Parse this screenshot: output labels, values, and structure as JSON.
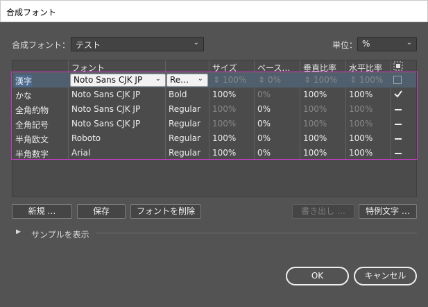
{
  "window": {
    "title": "合成フォント"
  },
  "composite_font": {
    "label": "合成フォント：",
    "value": "テスト"
  },
  "unit": {
    "label": "単位：",
    "value": "%"
  },
  "table": {
    "headers": {
      "font": "フォント",
      "size": "サイズ",
      "baseline": "ベース…",
      "vscale": "垂直比率",
      "hscale": "水平比率",
      "center_icon": "center-align-icon"
    },
    "rows": [
      {
        "category": "漢字",
        "font": "Noto Sans CJK JP",
        "style": "Re…",
        "size": "100%",
        "baseline": "0%",
        "vscale": "100%",
        "hscale": "100%",
        "check": "checkbox-empty"
      },
      {
        "category": "かな",
        "font": "Noto Sans CJK JP",
        "style": "Bold",
        "size": "100%",
        "baseline": "0%",
        "vscale": "100%",
        "hscale": "100%",
        "check": "checkmark"
      },
      {
        "category": "全角約物",
        "font": "Noto Sans CJK JP",
        "style": "Regular",
        "size": "100%",
        "baseline": "0%",
        "vscale": "100%",
        "hscale": "100%",
        "check": "dash"
      },
      {
        "category": "全角記号",
        "font": "Noto Sans CJK JP",
        "style": "Regular",
        "size": "100%",
        "baseline": "0%",
        "vscale": "100%",
        "hscale": "100%",
        "check": "dash"
      },
      {
        "category": "半角欧文",
        "font": "Roboto",
        "style": "Regular",
        "size": "100%",
        "baseline": "0%",
        "vscale": "100%",
        "hscale": "100%",
        "check": "dash"
      },
      {
        "category": "半角数字",
        "font": "Arial",
        "style": "Regular",
        "size": "100%",
        "baseline": "0%",
        "vscale": "100%",
        "hscale": "100%",
        "check": "dash"
      }
    ]
  },
  "buttons": {
    "new": "新規 …",
    "save": "保存",
    "delete_font": "フォントを削除",
    "export": "書き出し …",
    "exception": "特例文字 …"
  },
  "sample": {
    "label": "サンプルを表示"
  },
  "dialog": {
    "ok": "OK",
    "cancel": "キャンセル"
  },
  "colors": {
    "highlight_frame": "#c23cc9",
    "selected_row": "#4f5f6e",
    "background": "#535353"
  }
}
